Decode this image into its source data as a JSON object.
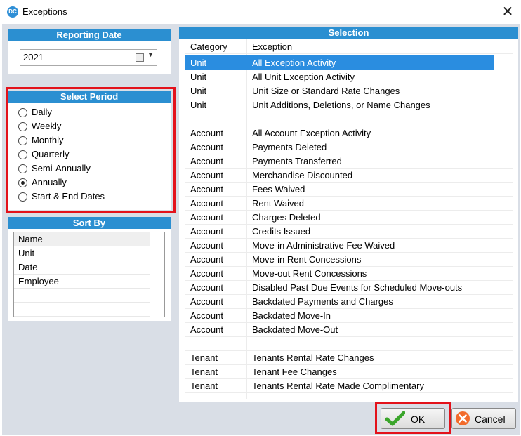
{
  "window": {
    "title": "Exceptions",
    "close_glyph": "✕",
    "app_icon_text": "DC"
  },
  "reporting_date": {
    "header": "Reporting Date",
    "value": "2021"
  },
  "select_period": {
    "header": "Select Period",
    "options": [
      "Daily",
      "Weekly",
      "Monthly",
      "Quarterly",
      "Semi-Annually",
      "Annually",
      "Start & End Dates"
    ],
    "selected": "Annually"
  },
  "sort_by": {
    "header": "Sort By",
    "items": [
      "Name",
      "Unit",
      "Date",
      "Employee"
    ],
    "selected": "Name"
  },
  "selection": {
    "header": "Selection",
    "columns": {
      "category": "Category",
      "exception": "Exception"
    },
    "rows": [
      {
        "category": "Unit",
        "exception": "All Exception Activity"
      },
      {
        "category": "Unit",
        "exception": "All Unit Exception Activity"
      },
      {
        "category": "Unit",
        "exception": "Unit Size or Standard Rate Changes"
      },
      {
        "category": "Unit",
        "exception": "Unit Additions, Deletions, or Name Changes"
      },
      {
        "category": "",
        "exception": ""
      },
      {
        "category": "Account",
        "exception": "All Account Exception Activity"
      },
      {
        "category": "Account",
        "exception": "Payments Deleted"
      },
      {
        "category": "Account",
        "exception": "Payments Transferred"
      },
      {
        "category": "Account",
        "exception": "Merchandise Discounted"
      },
      {
        "category": "Account",
        "exception": "Fees Waived"
      },
      {
        "category": "Account",
        "exception": "Rent Waived"
      },
      {
        "category": "Account",
        "exception": "Charges Deleted"
      },
      {
        "category": "Account",
        "exception": "Credits Issued"
      },
      {
        "category": "Account",
        "exception": "Move-in Administrative Fee Waived"
      },
      {
        "category": "Account",
        "exception": "Move-in Rent Concessions"
      },
      {
        "category": "Account",
        "exception": "Move-out Rent Concessions"
      },
      {
        "category": "Account",
        "exception": "Disabled Past Due Events for Scheduled Move-outs"
      },
      {
        "category": "Account",
        "exception": "Backdated Payments and Charges"
      },
      {
        "category": "Account",
        "exception": "Backdated Move-In"
      },
      {
        "category": "Account",
        "exception": "Backdated Move-Out"
      },
      {
        "category": "",
        "exception": ""
      },
      {
        "category": "Tenant",
        "exception": "Tenants Rental Rate Changes"
      },
      {
        "category": "Tenant",
        "exception": "Tenant Fee Changes"
      },
      {
        "category": "Tenant",
        "exception": "Tenants Rental Rate Made Complimentary"
      }
    ],
    "selected_index": 0
  },
  "buttons": {
    "ok": "OK",
    "cancel": "Cancel"
  },
  "icons": {
    "ok": "checkmark-icon",
    "cancel": "cancel-x-icon",
    "calendar": "calendar-icon",
    "dropdown": "chevron-down-icon"
  },
  "colors": {
    "accent": "#2b8fd1",
    "highlight": "#e3121b",
    "selected_row": "#2a8de0"
  }
}
